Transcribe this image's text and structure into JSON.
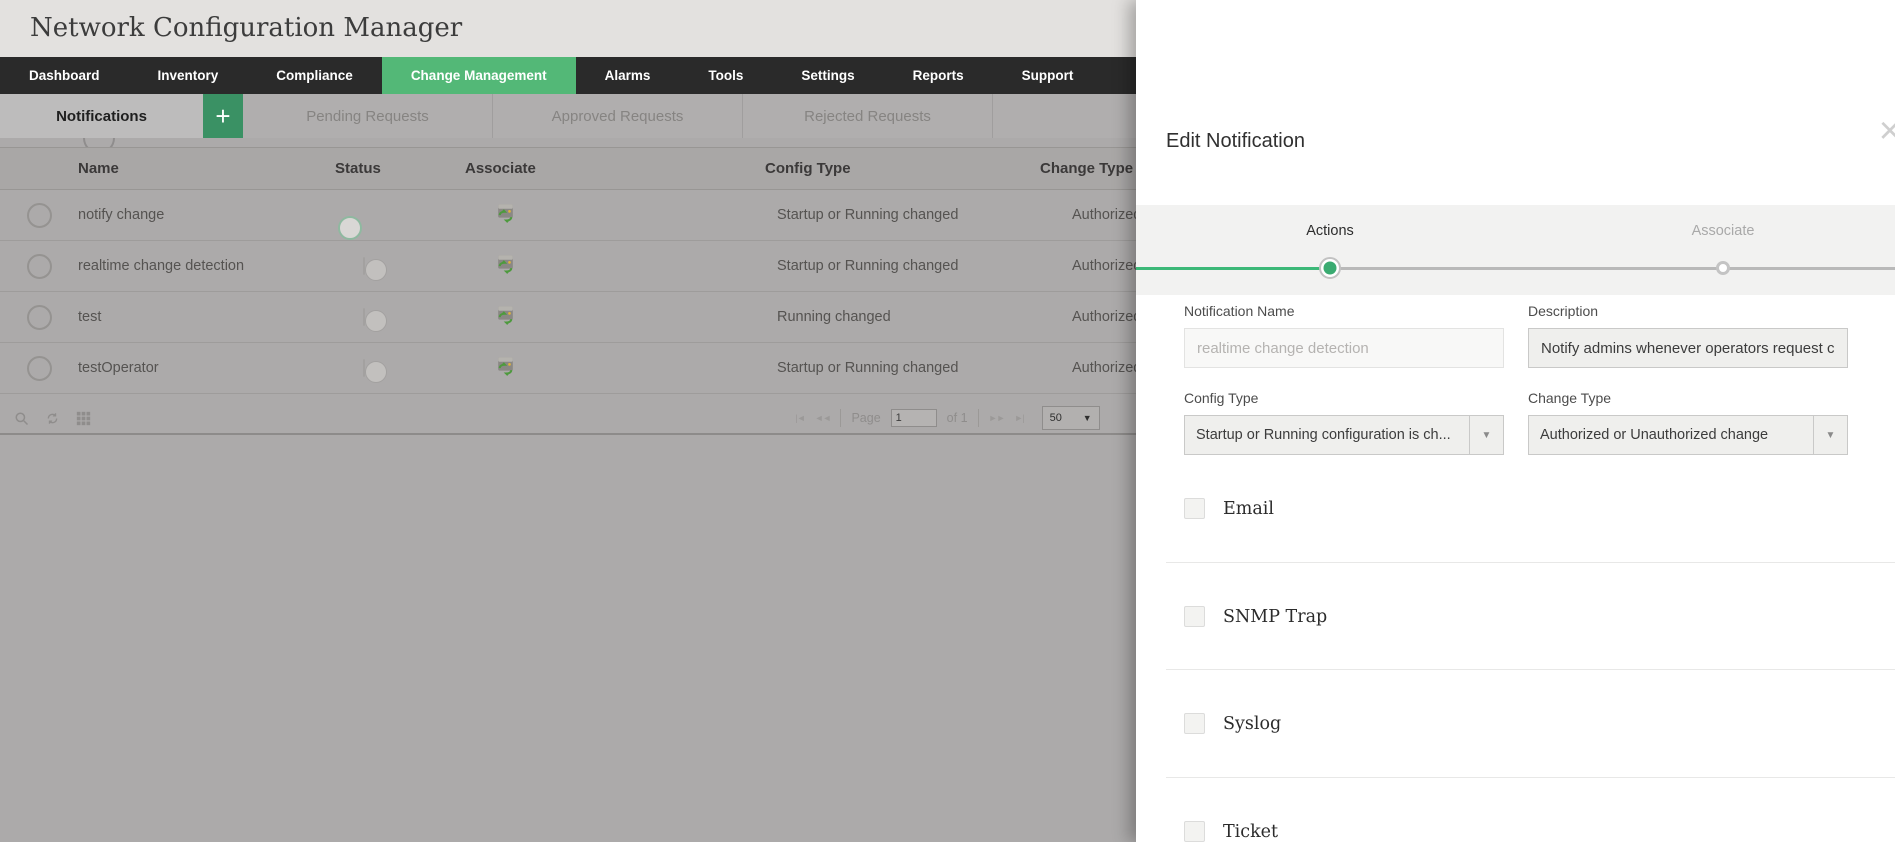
{
  "app": {
    "title": "Network Configuration Manager"
  },
  "header": {
    "icons": [
      "demo-screen",
      "rocket",
      "search",
      "notifications-bell",
      "settings-gear",
      "user-avatar"
    ]
  },
  "nav": {
    "items": [
      {
        "label": "Dashboard",
        "active": false
      },
      {
        "label": "Inventory",
        "active": false
      },
      {
        "label": "Compliance",
        "active": false
      },
      {
        "label": "Change Management",
        "active": true
      },
      {
        "label": "Alarms",
        "active": false
      },
      {
        "label": "Tools",
        "active": false
      },
      {
        "label": "Settings",
        "active": false
      },
      {
        "label": "Reports",
        "active": false
      },
      {
        "label": "Support",
        "active": false
      }
    ]
  },
  "subtabs": {
    "add_label": "+",
    "items": [
      {
        "label": "Notifications",
        "active": true
      },
      {
        "label": "Pending Requests",
        "active": false
      },
      {
        "label": "Approved Requests",
        "active": false
      },
      {
        "label": "Rejected Requests",
        "active": false
      }
    ]
  },
  "table": {
    "columns": {
      "name": "Name",
      "status": "Status",
      "associate": "Associate",
      "config_type": "Config Type",
      "change_type": "Change Type"
    },
    "rows": [
      {
        "name": "notify change",
        "enabled": true,
        "config_type": "Startup or Running changed",
        "change_type": "Authorized or Unauthorized change"
      },
      {
        "name": "realtime change detection",
        "enabled": false,
        "config_type": "Startup or Running changed",
        "change_type": "Authorized or Unauthorized change"
      },
      {
        "name": "test",
        "enabled": false,
        "config_type": "Running changed",
        "change_type": "Authorized or Unauthorized change"
      },
      {
        "name": "testOperator",
        "enabled": false,
        "config_type": "Startup or Running changed",
        "change_type": "Authorized or Unauthorized change"
      }
    ]
  },
  "pagination": {
    "first": "|◄",
    "prev": "◄◄",
    "page_label": "Page",
    "page_value": "1",
    "of_label": "of 1",
    "next": "►►",
    "last": "►|",
    "page_size": "50",
    "dropdown_arrow": "▼"
  },
  "panel": {
    "title": "Edit Notification",
    "close_label": "×",
    "steps": [
      {
        "label": "Actions",
        "active": true
      },
      {
        "label": "Associate",
        "active": false
      }
    ],
    "form": {
      "notification_name": {
        "label": "Notification Name",
        "placeholder": "realtime change detection"
      },
      "description": {
        "label": "Description",
        "value": "Notify admins whenever operators request c"
      },
      "config_type": {
        "label": "Config Type",
        "value": "Startup or Running configuration is ch...",
        "arrow": "▼"
      },
      "change_type": {
        "label": "Change Type",
        "value": "Authorized or Unauthorized change",
        "arrow": "▼"
      }
    },
    "checkboxes": [
      {
        "label": "Email",
        "checked": false
      },
      {
        "label": "SNMP Trap",
        "checked": false
      },
      {
        "label": "Syslog",
        "checked": false
      },
      {
        "label": "Ticket",
        "checked": false
      }
    ]
  },
  "colors": {
    "accent_green": "#53b877",
    "stepper_green": "#3cb878",
    "nav_dark": "#2a2a2a",
    "dim_gray": "#acaaaa"
  }
}
